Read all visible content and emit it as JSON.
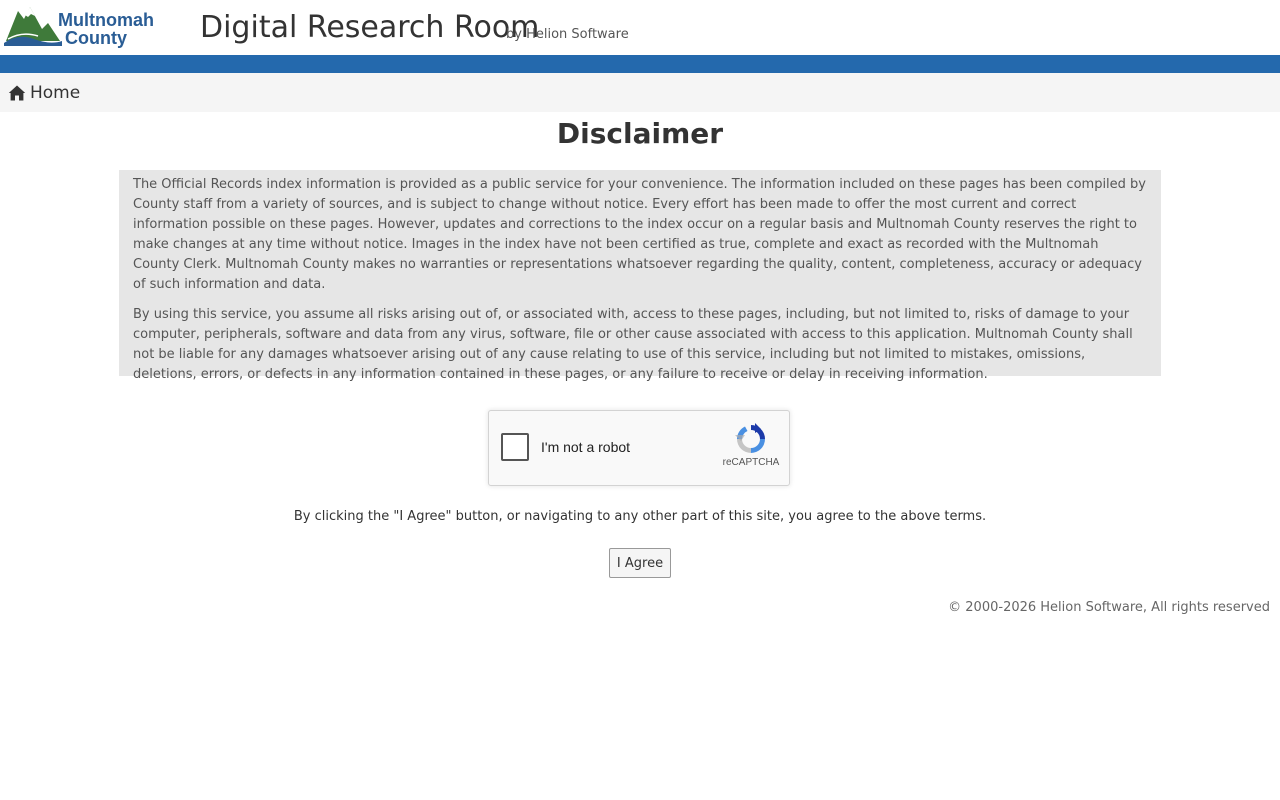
{
  "header": {
    "logo": {
      "line1": "Multnomah",
      "line2": "County",
      "icon": "mountain-logo-icon",
      "colors": {
        "mountain": "#3f7a3a",
        "water": "#2a5d95",
        "text": "#2a5d95"
      }
    },
    "title": "Digital Research Room",
    "subtitle": "by Helion Software"
  },
  "colors": {
    "accent_bar": "#2469ad",
    "nav_bg": "#f5f5f5",
    "disclaimer_bg": "#e6e6e6"
  },
  "nav": {
    "home": {
      "icon": "home-icon",
      "label": "Home"
    }
  },
  "main": {
    "title": "Disclaimer",
    "paragraphs": [
      "The Official Records index information is provided as a public service for your convenience. The information included on these pages has been compiled by County staff from a variety of sources, and is subject to change without notice. Every effort has been made to offer the most current and correct information possible on these pages. However, updates and corrections to the index occur on a regular basis and Multnomah County reserves the right to make changes at any time without notice. Images in the index have not been certified as true, complete and exact as recorded with the Multnomah County Clerk. Multnomah County makes no warranties or representations whatsoever regarding the quality, content, completeness, accuracy or adequacy of such information and data.",
      "By using this service, you assume all risks arising out of, or associated with, access to these pages, including, but not limited to, risks of damage to your computer, peripherals, software and data from any virus, software, file or other cause associated with access to this application. Multnomah County shall not be liable for any damages whatsoever arising out of any cause relating to use of this service, including but not limited to mistakes, omissions, deletions, errors, or defects in any information contained in these pages, or any failure to receive or delay in receiving information."
    ],
    "recaptcha": {
      "label": "I'm not a robot",
      "brand": "reCAPTCHA",
      "icon": "recaptcha-logo-icon",
      "checked": false
    },
    "agree_text": "By clicking the \"I Agree\" button, or navigating to any other part of this site, you agree to the above terms.",
    "agree_button": "I Agree"
  },
  "footer": {
    "copyright": "© 2000-2026 Helion Software, All rights reserved"
  }
}
